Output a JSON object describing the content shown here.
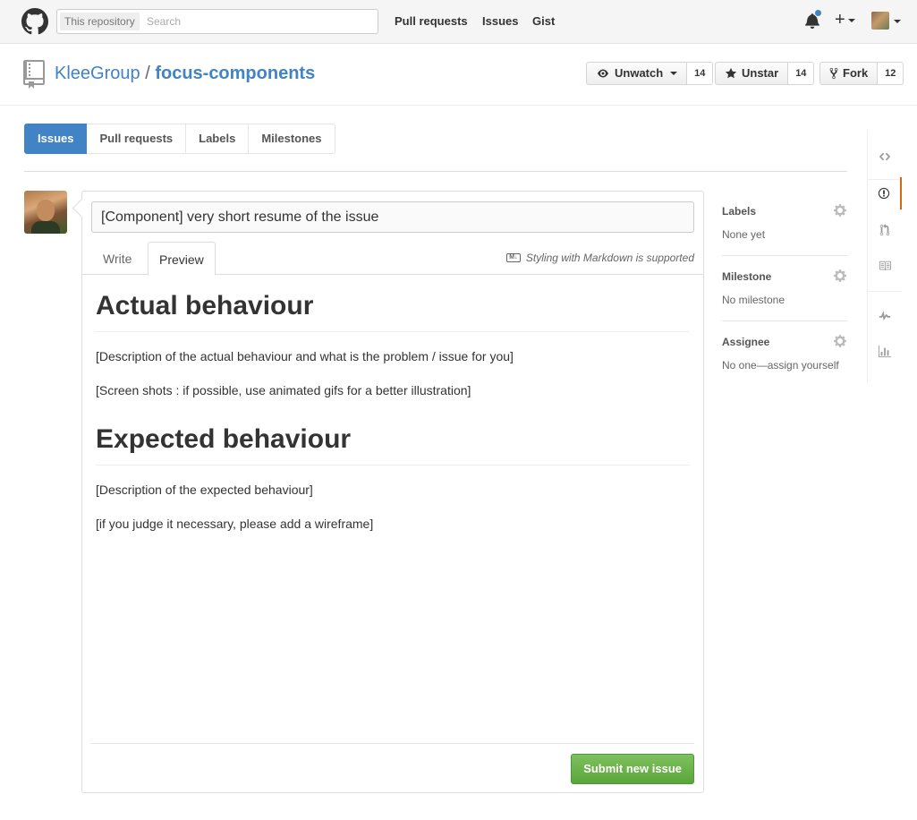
{
  "header": {
    "search_scope": "This repository",
    "search_placeholder": "Search",
    "nav": [
      "Pull requests",
      "Issues",
      "Gist"
    ],
    "plus_label": "+"
  },
  "repo": {
    "owner": "KleeGroup",
    "separator": "/",
    "name": "focus-components",
    "watch_label": "Unwatch",
    "watch_count": "14",
    "star_label": "Unstar",
    "star_count": "14",
    "fork_label": "Fork",
    "fork_count": "12"
  },
  "subnav": [
    "Issues",
    "Pull requests",
    "Labels",
    "Milestones"
  ],
  "issue": {
    "title_value": "[Component] very short resume of the issue",
    "tabs": [
      "Write",
      "Preview"
    ],
    "markdown_hint": "Styling with Markdown is supported",
    "markdown_icon_text": "M↓",
    "heading_1": "Actual behaviour",
    "para_1": "[Description of the actual behaviour and what is the problem / issue for you]",
    "para_2": "[Screen shots : if possible, use animated gifs for a better illustration]",
    "heading_2": "Expected behaviour",
    "para_3": "[Description of the expected behaviour]",
    "para_4": "[if you judge it necessary, please add a wireframe]",
    "submit_label": "Submit new issue"
  },
  "sidebar": {
    "labels_head": "Labels",
    "labels_val": "None yet",
    "milestone_head": "Milestone",
    "milestone_val": "No milestone",
    "assignee_head": "Assignee",
    "assignee_val": "No one—assign yourself"
  },
  "colors": {
    "accent": "#4183c4",
    "submit_green": "#6cc644",
    "rail_active": "#d26911"
  },
  "icons": [
    "github-logo-icon",
    "bell-icon",
    "plus-icon",
    "repo-icon",
    "eye-icon",
    "star-icon",
    "fork-icon",
    "code-icon",
    "issue-icon",
    "pull-request-icon",
    "wiki-icon",
    "pulse-icon",
    "graph-icon",
    "gear-icon",
    "markdown-icon"
  ]
}
